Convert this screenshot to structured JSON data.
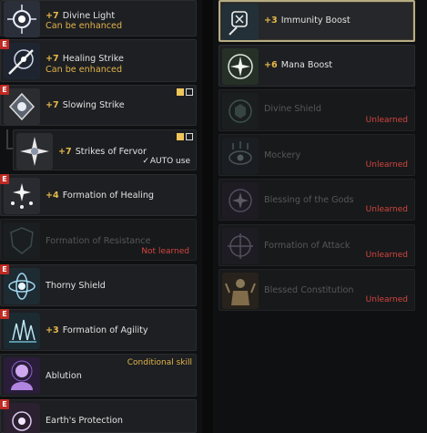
{
  "left": {
    "divine_light": {
      "level": "+7",
      "name": "Divine Light",
      "status": "Can be enhanced"
    },
    "healing_strike": {
      "level": "+7",
      "name": "Healing Strike",
      "status": "Can be enhanced"
    },
    "slowing_strike": {
      "level": "+7",
      "name": "Slowing Strike"
    },
    "strikes_of_fervor": {
      "level": "+7",
      "name": "Strikes of Fervor",
      "auto_label": "AUTO use"
    },
    "formation_of_healing": {
      "level": "+4",
      "name": "Formation of Healing"
    },
    "formation_of_resistance": {
      "name": "Formation of Resistance",
      "status": "Not learned"
    },
    "thorny_shield": {
      "name": "Thorny Shield"
    },
    "formation_of_agility": {
      "level": "+3",
      "name": "Formation of Agility"
    },
    "ablution": {
      "name": "Ablution",
      "tag": "Conditional skill"
    },
    "earths_protection": {
      "name": "Earth's Protection"
    }
  },
  "right": {
    "immunity_boost": {
      "level": "+3",
      "name": "Immunity Boost"
    },
    "mana_boost": {
      "level": "+6",
      "name": "Mana Boost"
    },
    "divine_shield": {
      "name": "Divine Shield",
      "status": "Unlearned"
    },
    "mockery": {
      "name": "Mockery",
      "status": "Unlearned"
    },
    "blessing_of_the_gods": {
      "name": "Blessing of the Gods",
      "status": "Unlearned"
    },
    "formation_of_attack": {
      "name": "Formation of Attack",
      "status": "Unlearned"
    },
    "blessed_constitution": {
      "name": "Blessed Constitution",
      "status": "Unlearned"
    }
  },
  "badge_letter": "E",
  "colors": {
    "level_gold": "#e6b94a",
    "status_red": "#d2463e",
    "enhance_gold": "#e3b44a",
    "badge_red": "#c02a23",
    "selected_border": "#b7ad84"
  }
}
